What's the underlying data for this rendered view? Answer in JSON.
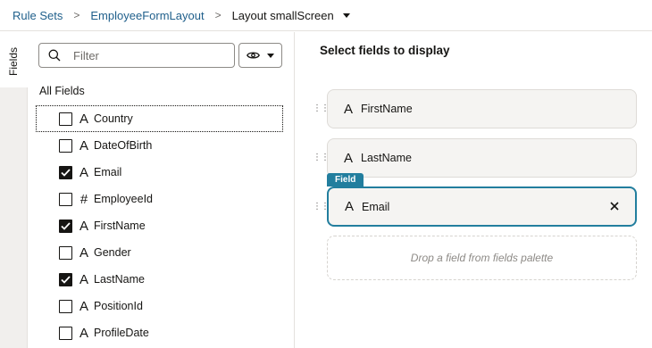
{
  "breadcrumb": {
    "items": [
      "Rule Sets",
      "EmployeeFormLayout"
    ],
    "current": "Layout smallScreen"
  },
  "rail": {
    "tab_label": "Fields"
  },
  "palette": {
    "filter_placeholder": "Filter",
    "section_title": "All Fields",
    "fields": [
      {
        "name": "Country",
        "type_glyph": "A",
        "checked": false
      },
      {
        "name": "DateOfBirth",
        "type_glyph": "A",
        "checked": false
      },
      {
        "name": "Email",
        "type_glyph": "A",
        "checked": true
      },
      {
        "name": "EmployeeId",
        "type_glyph": "#",
        "checked": false
      },
      {
        "name": "FirstName",
        "type_glyph": "A",
        "checked": true
      },
      {
        "name": "Gender",
        "type_glyph": "A",
        "checked": false
      },
      {
        "name": "LastName",
        "type_glyph": "A",
        "checked": true
      },
      {
        "name": "PositionId",
        "type_glyph": "A",
        "checked": false
      },
      {
        "name": "ProfileDate",
        "type_glyph": "A",
        "checked": false
      }
    ]
  },
  "canvas": {
    "title": "Select fields to display",
    "selected_badge": "Field",
    "slots": [
      {
        "name": "FirstName",
        "type_glyph": "A"
      },
      {
        "name": "LastName",
        "type_glyph": "A"
      },
      {
        "name": "Email",
        "type_glyph": "A"
      }
    ],
    "drop_hint": "Drop a field from fields palette"
  },
  "colors": {
    "link": "#1f5f8b",
    "accent": "#227e9e",
    "slot_background": "#f5f4f2"
  },
  "icons": {
    "search": "search-icon",
    "visibility": "eye-icon",
    "menu_caret": "chevron-down-icon",
    "remove": "close-icon",
    "drag": "drag-handle-icon"
  }
}
